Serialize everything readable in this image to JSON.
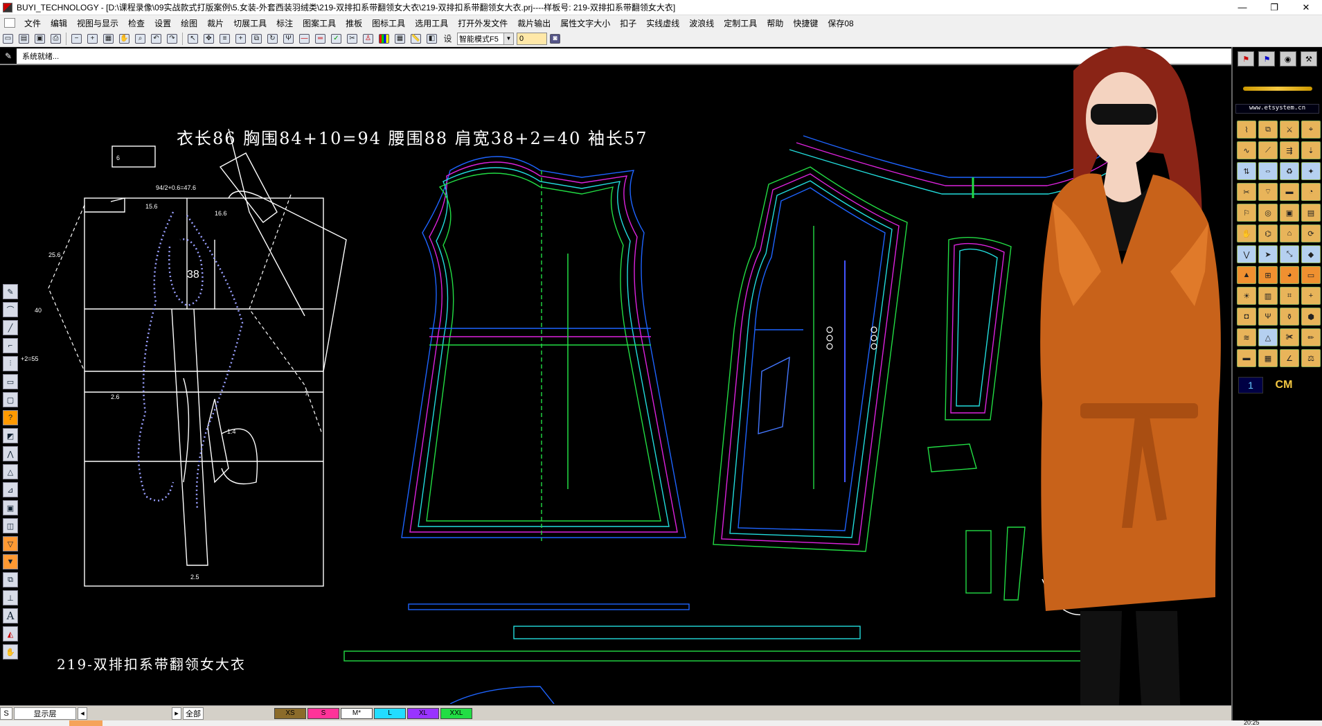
{
  "window": {
    "title": "BUYI_TECHNOLOGY - [D:\\课程录像\\09实战款式打版案例\\5.女装-外套西装羽绒类\\219-双排扣系带翻领女大衣\\219-双排扣系带翻领女大衣.prj----样板号: 219-双排扣系带翻领女大衣]",
    "minimize": "—",
    "restore": "❐",
    "close": "✕"
  },
  "menu": [
    "文件",
    "编辑",
    "视图与显示",
    "检查",
    "设置",
    "绘图",
    "裁片",
    "切展工具",
    "标注",
    "图案工具",
    "推板",
    "图标工具",
    "选用工具",
    "打开外发文件",
    "裁片输出",
    "属性文字大小",
    "扣子",
    "实线虚线",
    "波浪线",
    "定制工具",
    "帮助",
    "快捷键",
    "保存08"
  ],
  "toolbar": {
    "settings_label": "设",
    "mode_select": "智能模式F5",
    "number_value": "0"
  },
  "status": {
    "text": "系统就绪..."
  },
  "canvas": {
    "heading": "衣长86   胸围84+10=94   腰围88   肩宽38+2=40   袖长57",
    "style_name": "219-双排扣系带翻领女大衣",
    "dim_labels": {
      "bust_calc": "94/2+0.6=47.6",
      "d1": "15.6",
      "d2": "16.6",
      "d3": "25.6",
      "d4": "40",
      "d5": "+2=55",
      "d6": "2.6",
      "d7": "1.4",
      "d8": "2.5",
      "d9": "7",
      "d10": "38",
      "d11": "6"
    },
    "colors": {
      "draft": "#ffffff",
      "dashed": "#9aa0ff",
      "blue": "#1e64ff",
      "green": "#22dd44",
      "magenta": "#dd22dd",
      "cyan": "#22dddd"
    }
  },
  "right_panel": {
    "url": "www.etsystem.cn",
    "cm_label": "CM",
    "one_label": "1"
  },
  "bottom": {
    "s_label": "S",
    "layer_label": "显示层",
    "all_label": "全部",
    "sizes": [
      {
        "label": "XS",
        "color": "#8b6b2a"
      },
      {
        "label": "S",
        "color": "#ff3399"
      },
      {
        "label": "M*",
        "color": "#ffffff"
      },
      {
        "label": "L",
        "color": "#22ddff"
      },
      {
        "label": "XL",
        "color": "#9933ff"
      },
      {
        "label": "XXL",
        "color": "#22dd44"
      }
    ]
  },
  "clock": "20:25"
}
